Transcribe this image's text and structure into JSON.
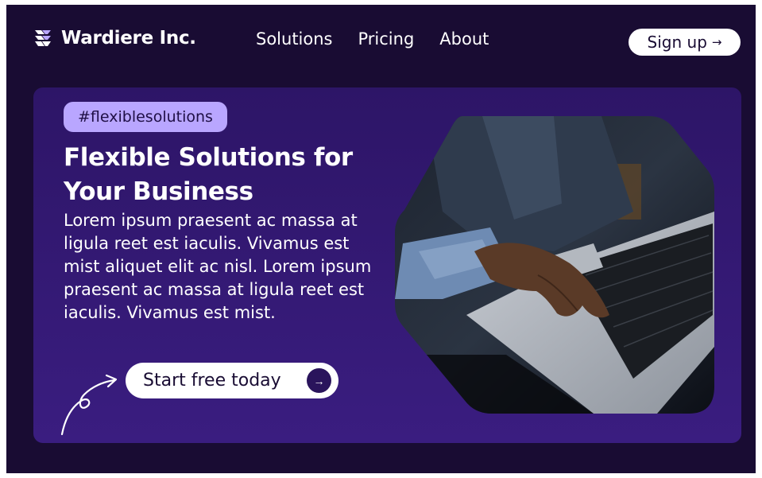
{
  "brand": {
    "name": "Wardiere Inc.",
    "icon": "brand-mark-icon"
  },
  "nav": {
    "items": [
      "Solutions",
      "Pricing",
      "About"
    ]
  },
  "header": {
    "signup_label": "Sign up",
    "signup_arrow": "→"
  },
  "hero": {
    "tag": "#flexiblesolutions",
    "headline": "Flexible Solutions for Your Business",
    "body": "Lorem ipsum praesent ac massa at ligula reet est iaculis. Vivamus est mist aliquet elit ac nisl. Lorem ipsum praesent ac massa at ligula reet est iaculis. Vivamus est mist.",
    "cta_label": "Start free today",
    "cta_arrow": "→",
    "image": "person-typing-on-laptop-photo"
  },
  "colors": {
    "background": "#190c33",
    "hero_panel": "#341a75",
    "tag_bg": "#b9a6ff",
    "button_bg": "#ffffff"
  }
}
